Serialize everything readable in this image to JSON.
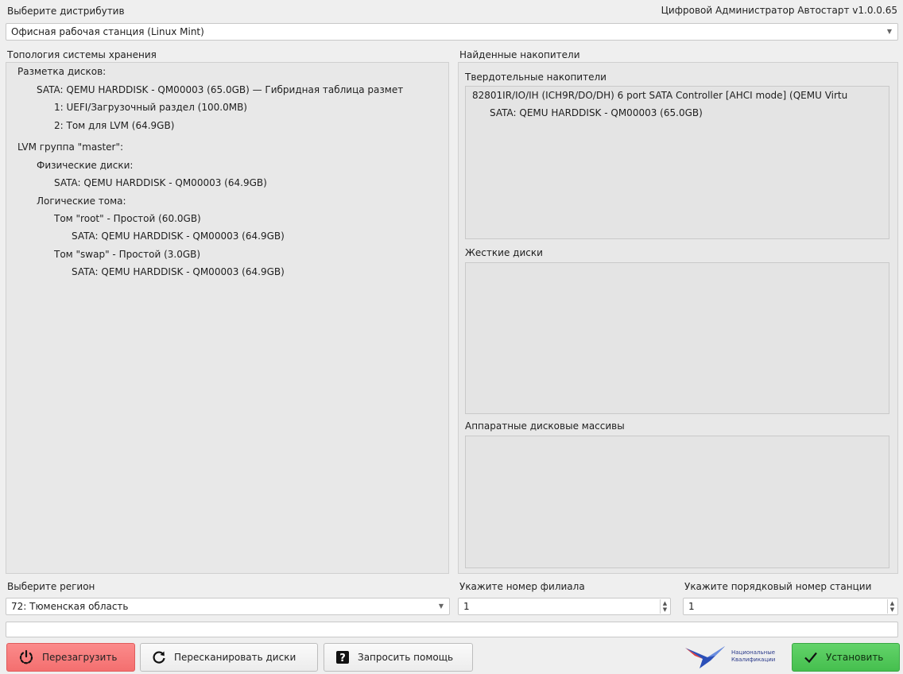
{
  "header": {
    "distro_label": "Выберите дистрибутив",
    "app_title": "Цифровой Администратор Автостарт  v1.0.0.65",
    "distro_value": "Офисная рабочая станция (Linux Mint)"
  },
  "topology": {
    "label": "Топология системы хранения",
    "lines": [
      "Разметка дисков:",
      "SATA: QEMU HARDDISK - QM00003 (65.0GB) — Гибридная таблица размет",
      "1: UEFI/Загрузочный раздел (100.0MB)",
      "2: Том для LVM (64.9GB)",
      "LVM группа \"master\":",
      "Физические диски:",
      "SATA: QEMU HARDDISK - QM00003 (64.9GB)",
      "Логические тома:",
      "Том \"root\" - Простой (60.0GB)",
      "SATA: QEMU HARDDISK - QM00003 (64.9GB)",
      "Том \"swap\" - Простой (3.0GB)",
      "SATA: QEMU HARDDISK - QM00003 (64.9GB)"
    ]
  },
  "found": {
    "label": "Найденные накопители",
    "ssd_label": "Твердотельные накопители",
    "ssd_lines": [
      "82801IR/IO/IH (ICH9R/DO/DH) 6 port SATA Controller [AHCI mode] (QEMU Virtu",
      "SATA: QEMU HARDDISK - QM00003 (65.0GB)"
    ],
    "hdd_label": "Жесткие диски",
    "raid_label": "Аппаратные дисковые массивы"
  },
  "region": {
    "label": "Выберите регион",
    "value": "72: Тюменская область"
  },
  "branch": {
    "label": "Укажите номер филиала",
    "value": "1"
  },
  "station": {
    "label": "Укажите порядковый номер станции",
    "value": "1"
  },
  "status_text": "",
  "buttons": {
    "reboot": "Перезагрузить",
    "rescan": "Пересканировать диски",
    "help": "Запросить помощь",
    "install": "Установить"
  },
  "logo": {
    "line1": "Национальные",
    "line2": "Квалификации"
  },
  "colors": {
    "reboot_bg": "#f46f6f",
    "install_bg": "#45bf4e"
  }
}
